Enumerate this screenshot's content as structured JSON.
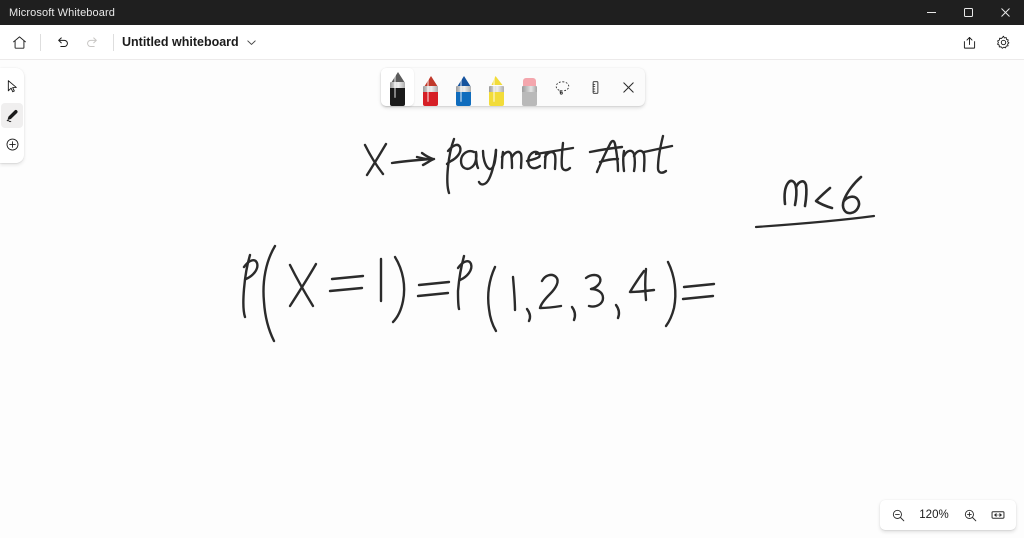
{
  "window": {
    "app_title": "Microsoft Whiteboard",
    "controls": [
      {
        "name": "minimize",
        "label": "—"
      },
      {
        "name": "maximize",
        "label": "□"
      },
      {
        "name": "close",
        "label": "×"
      }
    ]
  },
  "toolbar": {
    "home_icon": "home-icon",
    "undo_icon": "undo-icon",
    "redo_icon": "redo-icon",
    "redo_disabled": true,
    "document_title": "Untitled whiteboard",
    "title_chevron_icon": "chevron-down-icon",
    "share_icon": "share-icon",
    "settings_icon": "gear-icon"
  },
  "left_rail": {
    "items": [
      {
        "name": "select-tool",
        "icon": "cursor-arrow-icon",
        "selected": false
      },
      {
        "name": "pen-tool",
        "icon": "pen-icon",
        "selected": true
      },
      {
        "name": "add-tool",
        "icon": "plus-circle-icon",
        "selected": false
      }
    ]
  },
  "pen_toolbar": {
    "pens": [
      {
        "name": "black-pen",
        "color": "#1a1a1a",
        "type": "pen",
        "selected": true
      },
      {
        "name": "red-pen",
        "color": "#d61f26",
        "type": "pen",
        "selected": false
      },
      {
        "name": "blue-pen",
        "color": "#0f6cbd",
        "type": "pen",
        "selected": false
      },
      {
        "name": "yellow-highlighter",
        "color": "#f2dc3a",
        "type": "highlighter",
        "selected": false
      },
      {
        "name": "eraser",
        "color": "#b9b9b9",
        "type": "eraser",
        "selected": false
      }
    ],
    "lasso_icon": "lasso-select-icon",
    "ruler_icon": "ruler-icon",
    "close_icon": "close-icon"
  },
  "canvas": {
    "background_color": "#fdfdfd",
    "ink_color": "#2b2b2b",
    "strokes": [
      {
        "name": "ink-line-definition",
        "text": "X → Payment Amt"
      },
      {
        "name": "ink-heading-constraint",
        "text": "n ∠ 6"
      },
      {
        "name": "ink-underline",
        "text": ""
      },
      {
        "name": "ink-probability-expression",
        "text": "P(X = 1) = P (1, 2, 3, 4) ="
      }
    ]
  },
  "zoom_controls": {
    "zoom_out_icon": "zoom-out-icon",
    "level": "120%",
    "zoom_in_icon": "zoom-in-icon",
    "fit_icon": "fit-to-screen-icon"
  }
}
